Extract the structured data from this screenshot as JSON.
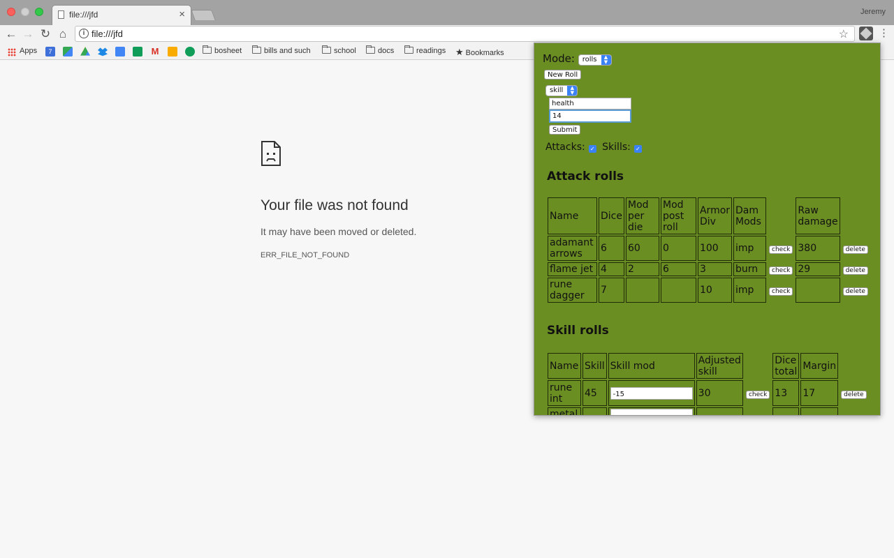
{
  "browser": {
    "tab_title": "file:///jfd",
    "tab_close": "×",
    "profile_name": "Jeremy",
    "url": "file:///jfd",
    "nav": {
      "back": "←",
      "forward": "→",
      "reload": "↻",
      "home": "⌂"
    },
    "star": "☆",
    "menu": "⋮"
  },
  "bookmarks": {
    "apps": "Apps",
    "folders": [
      "bosheet",
      "bills and such",
      "school",
      "docs",
      "readings"
    ],
    "bookmarks_label": "Bookmarks",
    "icon_colors": [
      "#3f6fd9",
      "#34a853",
      "#fbbc05",
      "#1e88e5",
      "#4285f4",
      "#0f9d58",
      "#d93025",
      "#f9ab00",
      "#0f9d58"
    ]
  },
  "error_page": {
    "title": "Your file was not found",
    "message": "It may have been moved or deleted.",
    "code": "ERR_FILE_NOT_FOUND"
  },
  "popup": {
    "mode_label": "Mode:",
    "mode_value": "rolls",
    "new_roll_label": "New Roll",
    "roll_type_value": "skill",
    "field_name_value": "health",
    "field_value_value": "14",
    "submit_label": "Submit",
    "attacks_label": "Attacks:",
    "skills_label": "Skills:",
    "attack_section_title": "Attack rolls",
    "attack_headers": {
      "name": "Name",
      "dice": "Dice",
      "mod_per_die": "Mod per die",
      "mod_post_roll": "Mod post roll",
      "armor_div": "Armor Div",
      "dam_mods": "Dam Mods",
      "raw_damage": "Raw damage"
    },
    "attack_rows": [
      {
        "name": "adamant arrows",
        "dice": "6",
        "mod_per_die": "60",
        "mod_post_roll": "0",
        "armor_div": "100",
        "dam_mods": "imp",
        "raw_damage": "380"
      },
      {
        "name": "flame jet",
        "dice": "4",
        "mod_per_die": "2",
        "mod_post_roll": "6",
        "armor_div": "3",
        "dam_mods": "burn",
        "raw_damage": "29"
      },
      {
        "name": "rune dagger",
        "dice": "7",
        "mod_per_die": "",
        "mod_post_roll": "",
        "armor_div": "10",
        "dam_mods": "imp",
        "raw_damage": ""
      }
    ],
    "check_label": "check",
    "delete_label": "delete",
    "skill_section_title": "Skill rolls",
    "skill_headers": {
      "name": "Name",
      "skill": "Skill",
      "skill_mod": "Skill mod",
      "adjusted_skill": "Adjusted skill",
      "dice_total": "Dice total",
      "margin": "Margin"
    },
    "skill_rows": [
      {
        "name": "rune int",
        "skill": "45",
        "skill_mod": "-15",
        "adjusted_skill": "30",
        "dice_total": "13",
        "margin": "17"
      },
      {
        "name": "metal",
        "skill": "",
        "skill_mod": "",
        "adjusted_skill": "",
        "dice_total": "",
        "margin": ""
      }
    ]
  }
}
